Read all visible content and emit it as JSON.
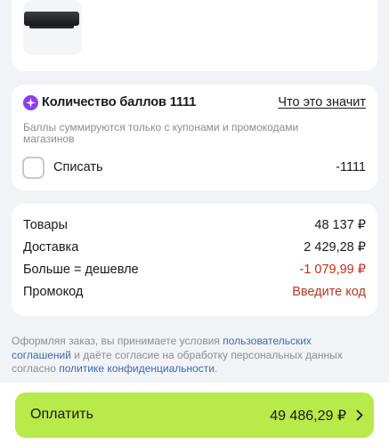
{
  "points": {
    "title": "Количество баллов 1111",
    "info_link": "Что это значит",
    "note": "Баллы суммируются только с купонами и промокодами магазинов",
    "writeoff_label": "Списать",
    "writeoff_value": "-1111",
    "writeoff_checked": false,
    "icon": "star-badge-icon",
    "icon_color": "#8a3ef0"
  },
  "summary": {
    "goods_label": "Товары",
    "goods_value": "48 137 ₽",
    "delivery_label": "Доставка",
    "delivery_value": "2 429,28 ₽",
    "discount_label": "Больше = дешевле",
    "discount_value": "-1 079,99 ₽",
    "promo_label": "Промокод",
    "promo_link": "Введите код"
  },
  "legal": {
    "part1": "Оформляя заказ, вы принимаете условия ",
    "link1": "пользовательских соглашений",
    "part2": " и даёте согласие на обработку персональных данных согласно ",
    "link2": "политике конфиденциальности",
    "part3": "."
  },
  "pay": {
    "label": "Оплатить",
    "amount": "49 486,29 ₽",
    "button_color": "#b8ea4a"
  },
  "colors": {
    "accent_red": "#c62a16",
    "link_blue": "#3d6ab0"
  }
}
